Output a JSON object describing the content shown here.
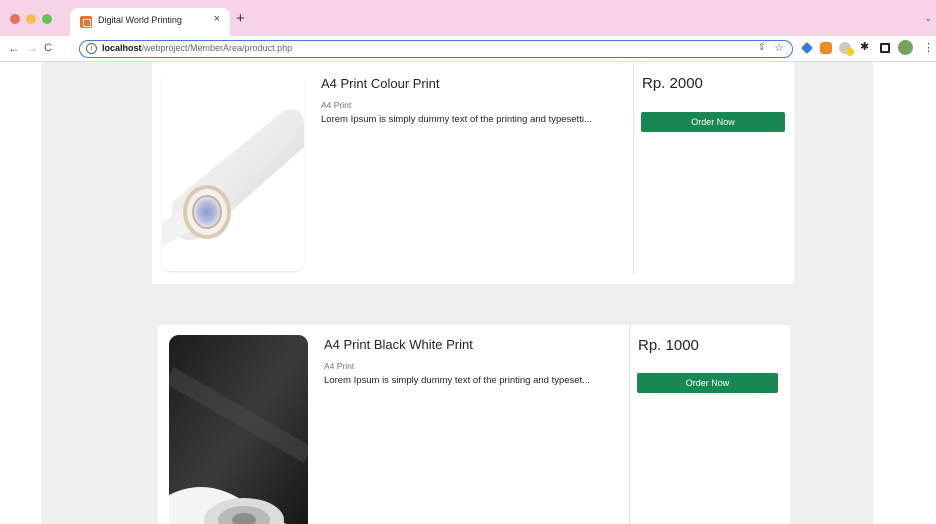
{
  "browser": {
    "tab_title": "Digital World Printing",
    "tab_close": "×",
    "new_tab": "+",
    "url_host": "localhost",
    "url_path": "/webproject/MemberArea/product.php"
  },
  "products": [
    {
      "title": "A4 Print Colour Print",
      "category": "A4 Print",
      "description": "Lorem Ipsum is simply dummy text of the printing and typesetti...",
      "price": "Rp. 2000",
      "order_label": "Order Now"
    },
    {
      "title": "A4 Print Black White Print",
      "category": "A4 Print",
      "description": "Lorem Ipsum is simply dummy text of the printing and typeset...",
      "price": "Rp. 1000",
      "order_label": "Order Now"
    }
  ],
  "colors": {
    "tabbar": "#f6d3e6",
    "order_button": "#198754",
    "page_background": "#efefef"
  }
}
